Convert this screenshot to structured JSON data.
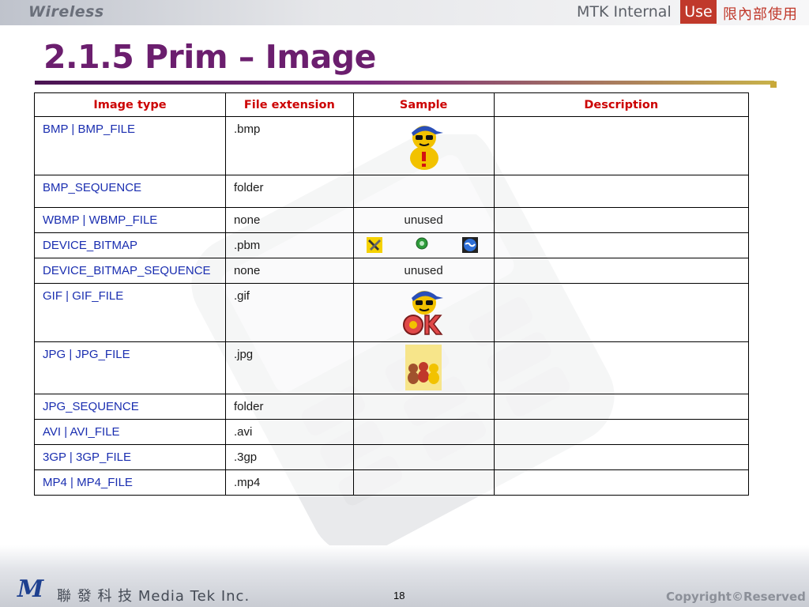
{
  "header": {
    "brand_left": "Wireless",
    "mtk_internal": "MTK Internal",
    "use_badge": "Use",
    "cn_internal": "限內部使用"
  },
  "title": "2.1.5 Prim – Image",
  "table": {
    "headers": [
      "Image type",
      "File extension",
      "Sample",
      "Description"
    ],
    "rows": [
      {
        "type": "BMP | BMP_FILE",
        "ext": ".bmp",
        "sample": "",
        "desc": ""
      },
      {
        "type": "BMP_SEQUENCE",
        "ext": "folder",
        "sample": "",
        "desc": ""
      },
      {
        "type": "WBMP | WBMP_FILE",
        "ext": "none",
        "sample": "unused",
        "desc": ""
      },
      {
        "type": "DEVICE_BITMAP",
        "ext": ".pbm",
        "sample": "",
        "desc": ""
      },
      {
        "type": "DEVICE_BITMAP_SEQUENCE",
        "ext": "none",
        "sample": "unused",
        "desc": ""
      },
      {
        "type": "GIF | GIF_FILE",
        "ext": ".gif",
        "sample": "",
        "desc": ""
      },
      {
        "type": "JPG | JPG_FILE",
        "ext": ".jpg",
        "sample": "",
        "desc": ""
      },
      {
        "type": "JPG_SEQUENCE",
        "ext": "folder",
        "sample": "",
        "desc": ""
      },
      {
        "type": "AVI | AVI_FILE",
        "ext": ".avi",
        "sample": "",
        "desc": ""
      },
      {
        "type": "3GP | 3GP_FILE",
        "ext": ".3gp",
        "sample": "",
        "desc": ""
      },
      {
        "type": "MP4 | MP4_FILE",
        "ext": ".mp4",
        "sample": "",
        "desc": ""
      }
    ]
  },
  "footer": {
    "logo_letter": "M",
    "company": "聯 發 科 技 Media Tek Inc.",
    "page_number": "18",
    "copyright": "Copyright©Reserved"
  },
  "colors": {
    "title": "#6b1e6e",
    "header_text": "#cc0000",
    "type_text": "#1a2eb0",
    "use_badge": "#c0392b"
  }
}
